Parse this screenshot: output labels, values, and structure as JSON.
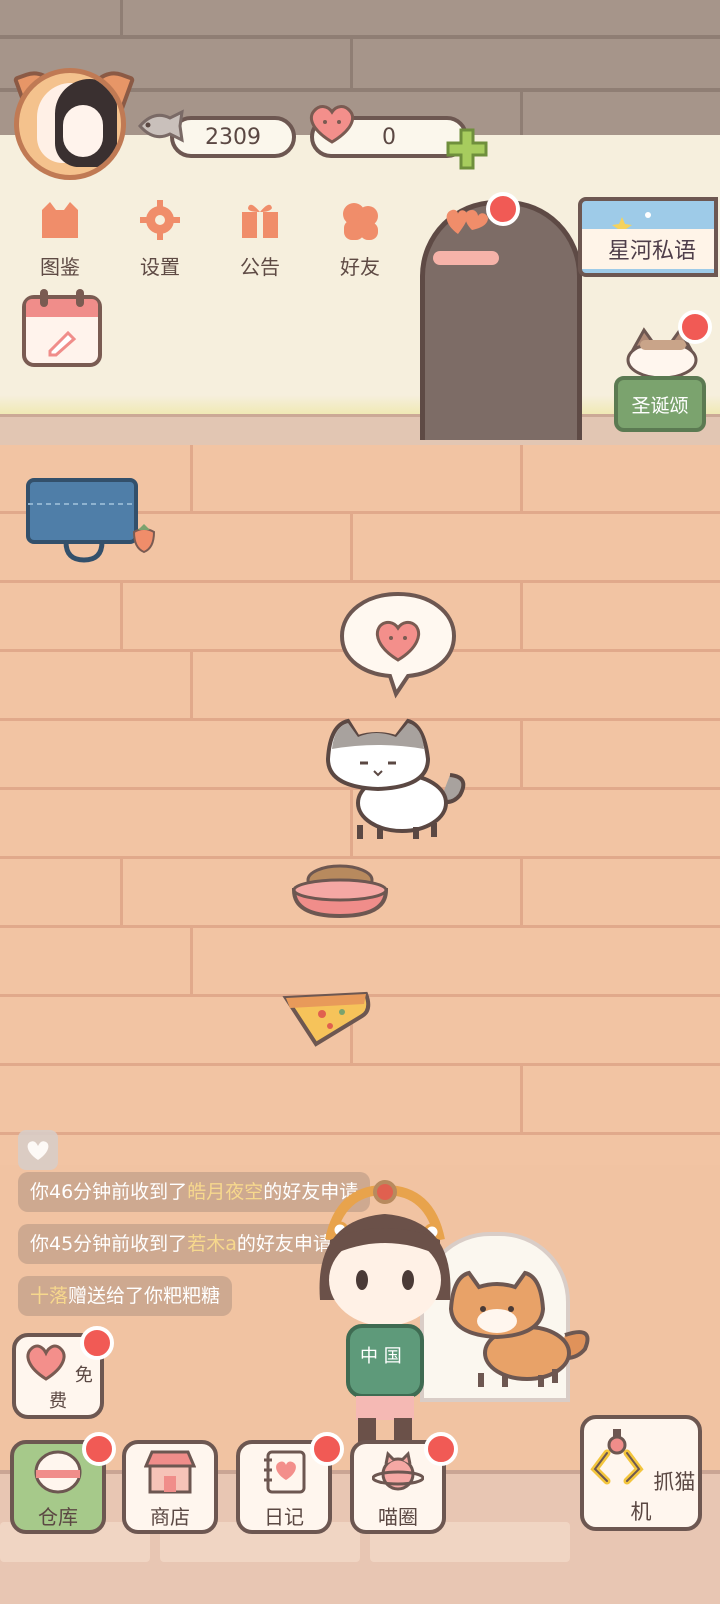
{
  "hud": {
    "fish_count": "2309",
    "heart_count": "0"
  },
  "nav": [
    {
      "id": "atlas",
      "label": "图鉴",
      "icon": "cat-head-icon"
    },
    {
      "id": "settings",
      "label": "设置",
      "icon": "gear-icon"
    },
    {
      "id": "notice",
      "label": "公告",
      "icon": "gift-icon"
    },
    {
      "id": "friends",
      "label": "好友",
      "icon": "friends-icon"
    },
    {
      "id": "event",
      "label": "",
      "icon": "hearts-icon"
    }
  ],
  "banner": {
    "label": "星河私语"
  },
  "event_button": {
    "label": "圣诞颂"
  },
  "chat": [
    {
      "prefix": "你46分钟前收到了",
      "name": "皓月夜空",
      "suffix": "的好友申请"
    },
    {
      "prefix": "你45分钟前收到了",
      "name": "若木a",
      "suffix": "的好友申请"
    },
    {
      "prefix": "",
      "name": "十落",
      "suffix": "赠送给了你粑粑糖"
    }
  ],
  "free_button": {
    "label": "免费"
  },
  "bottom_bar": [
    {
      "id": "warehouse",
      "label": "仓库",
      "icon": "storage-icon",
      "active": true
    },
    {
      "id": "shop",
      "label": "商店",
      "icon": "shop-icon",
      "active": false
    },
    {
      "id": "diary",
      "label": "日记",
      "icon": "diary-icon",
      "active": false
    },
    {
      "id": "circle",
      "label": "喵圈",
      "icon": "planet-cat-icon",
      "active": false
    }
  ],
  "claw_machine": {
    "label": "抓猫机"
  },
  "colors": {
    "floor": "#f2c4a3",
    "wall": "#f6efdd",
    "badge": "#f15a55",
    "accent_green": "#a6c98a",
    "outline": "#6d5751"
  }
}
